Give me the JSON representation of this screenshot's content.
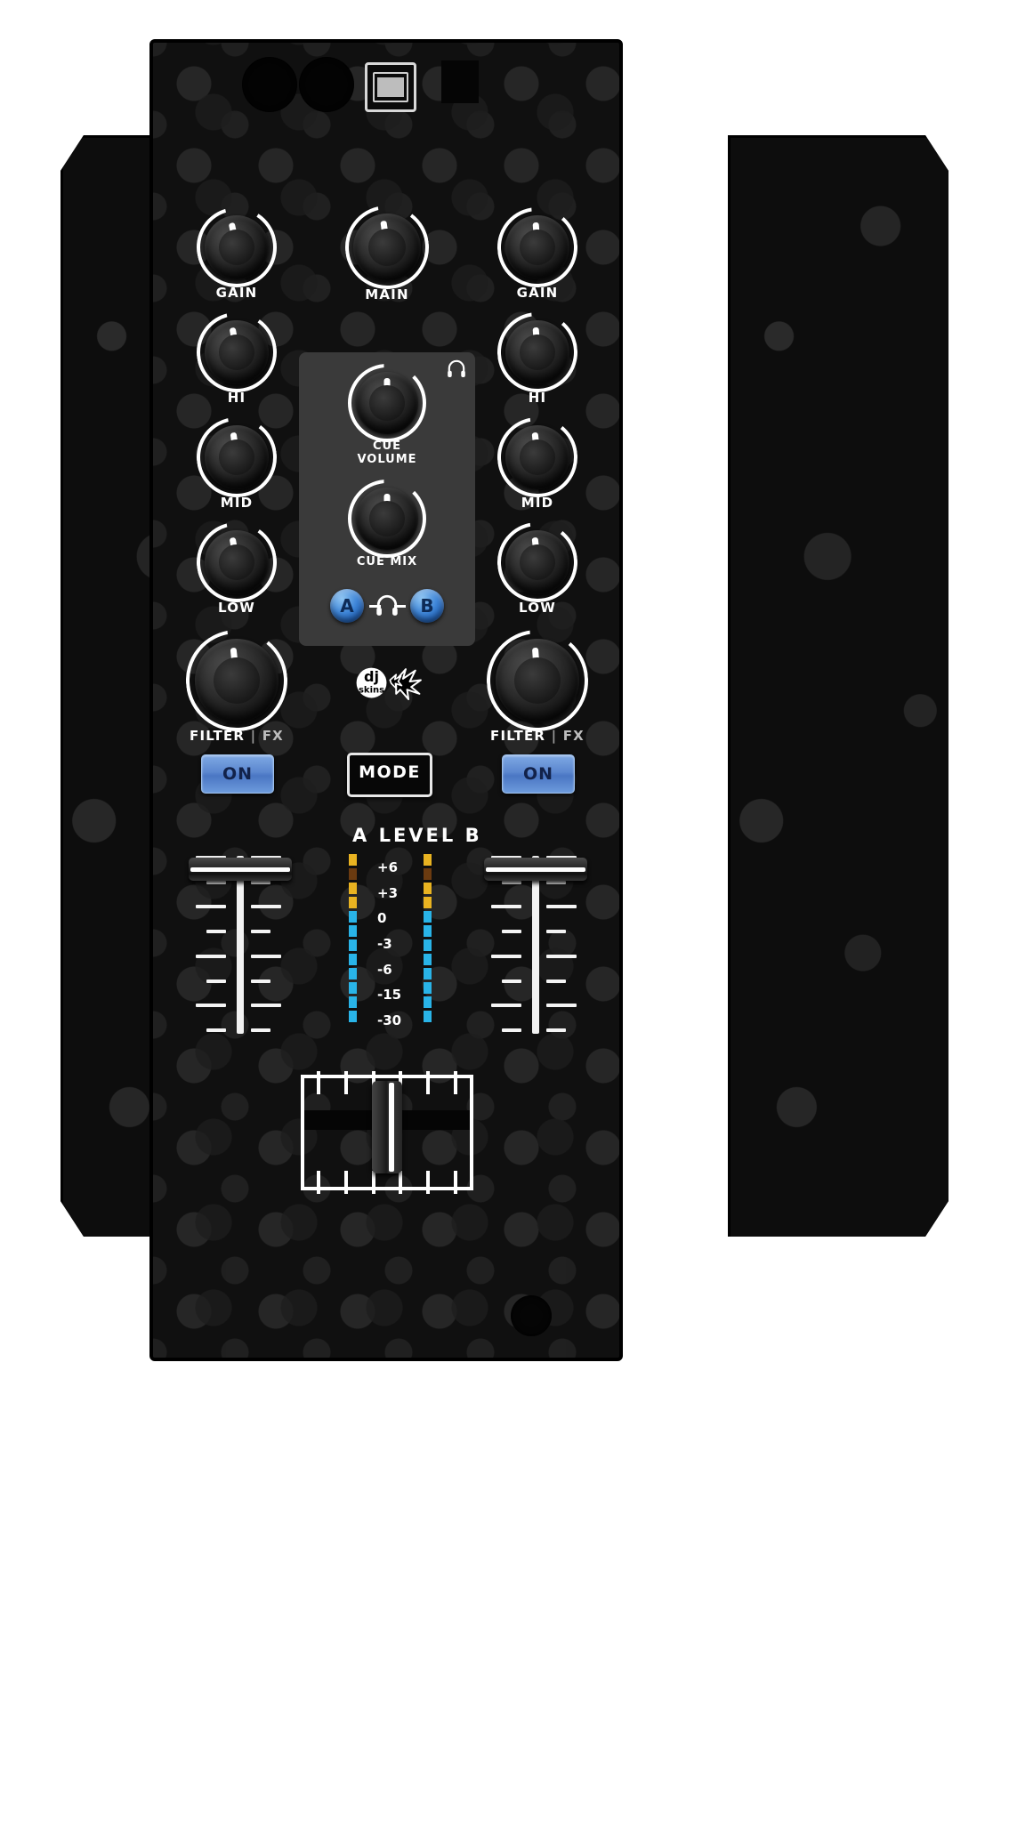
{
  "device": {
    "name": "dj-mixer-skin-faceplate",
    "brand_logo_text_top": "dj",
    "brand_logo_text_bottom": "skins",
    "body_color": "#101010",
    "accent_blue": "#5b87cf",
    "panel_grey": "#3a3a3a",
    "meter_yellow": "#e9b321",
    "meter_cyan": "#29b4e8",
    "label_white": "#ffffff"
  },
  "top_ports": {
    "rca_left_label": "rca-jack-left",
    "rca_right_label": "rca-jack-right",
    "usb_label": "usb-b-port",
    "square_label": "power-port"
  },
  "channel_a": {
    "side": "A",
    "knobs": [
      {
        "label": "GAIN",
        "value_deg": -12
      },
      {
        "label": "HI",
        "value_deg": -10
      },
      {
        "label": "MID",
        "value_deg": -8
      },
      {
        "label": "LOW",
        "value_deg": -10
      }
    ],
    "filter_label_main": "FILTER",
    "filter_label_sep": "|",
    "filter_label_alt": "FX",
    "filter_knob_value_deg": -6,
    "on_button": "ON"
  },
  "channel_b": {
    "side": "B",
    "knobs": [
      {
        "label": "GAIN",
        "value_deg": -4
      },
      {
        "label": "HI",
        "value_deg": -4
      },
      {
        "label": "MID",
        "value_deg": -6
      },
      {
        "label": "LOW",
        "value_deg": -6
      }
    ],
    "filter_label_main": "FILTER",
    "filter_label_sep": "|",
    "filter_label_alt": "FX",
    "filter_knob_value_deg": -4,
    "on_button": "ON"
  },
  "master": {
    "main_knob_label": "MAIN",
    "main_knob_value_deg": -8,
    "mode_button": "MODE"
  },
  "cue_panel": {
    "headphone_icon": "headphone-icon",
    "volume_knob_label": "CUE VOLUME",
    "volume_knob_value_deg": 0,
    "mix_knob_label": "CUE MIX",
    "mix_knob_value_deg": 0,
    "cue_a_button": "A",
    "cue_b_button": "B",
    "cue_divider_icon": "headphone-icon"
  },
  "level_meter": {
    "title": "A LEVEL B",
    "scale_labels": [
      "+6",
      "+3",
      "0",
      "-3",
      "-6",
      "-15",
      "-30"
    ],
    "segments_yellow": 4,
    "segments_cyan": 8,
    "channel_a_segments_lit": 12,
    "channel_b_segments_lit": 12
  },
  "crossfader": {
    "name": "crossfader",
    "position_percent": 50,
    "tick_count_top": 6,
    "tick_count_bottom": 6
  },
  "line_faders": {
    "fader_a_position_percent": 96,
    "fader_b_position_percent": 96,
    "tick_count": 8
  }
}
